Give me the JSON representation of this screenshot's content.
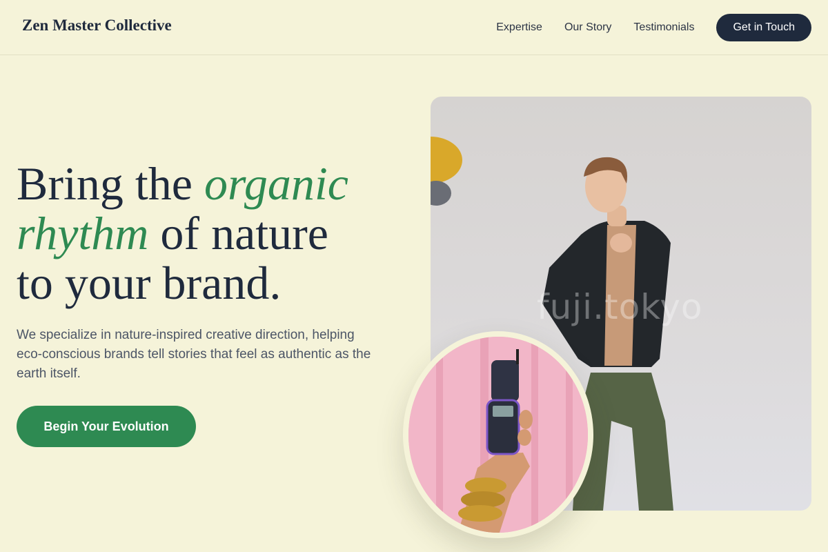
{
  "header": {
    "brand": "Zen Master Collective",
    "nav": [
      "Expertise",
      "Our Story",
      "Testimonials"
    ],
    "cta": "Get in Touch"
  },
  "hero": {
    "title_part1": "Bring the ",
    "title_em1": "organic",
    "title_em2": "rhythm",
    "title_part2": " of nature",
    "title_part3": "to your brand.",
    "subtitle": "We specialize in nature-inspired creative direction, helping eco-conscious brands tell stories that feel as authentic as the earth itself.",
    "cta": "Begin Your Evolution"
  },
  "images": {
    "main_watermark": "fuji.tokyo"
  },
  "colors": {
    "background": "#f5f3d9",
    "primary_dark": "#1f2a3d",
    "accent_green": "#2e8a52"
  }
}
